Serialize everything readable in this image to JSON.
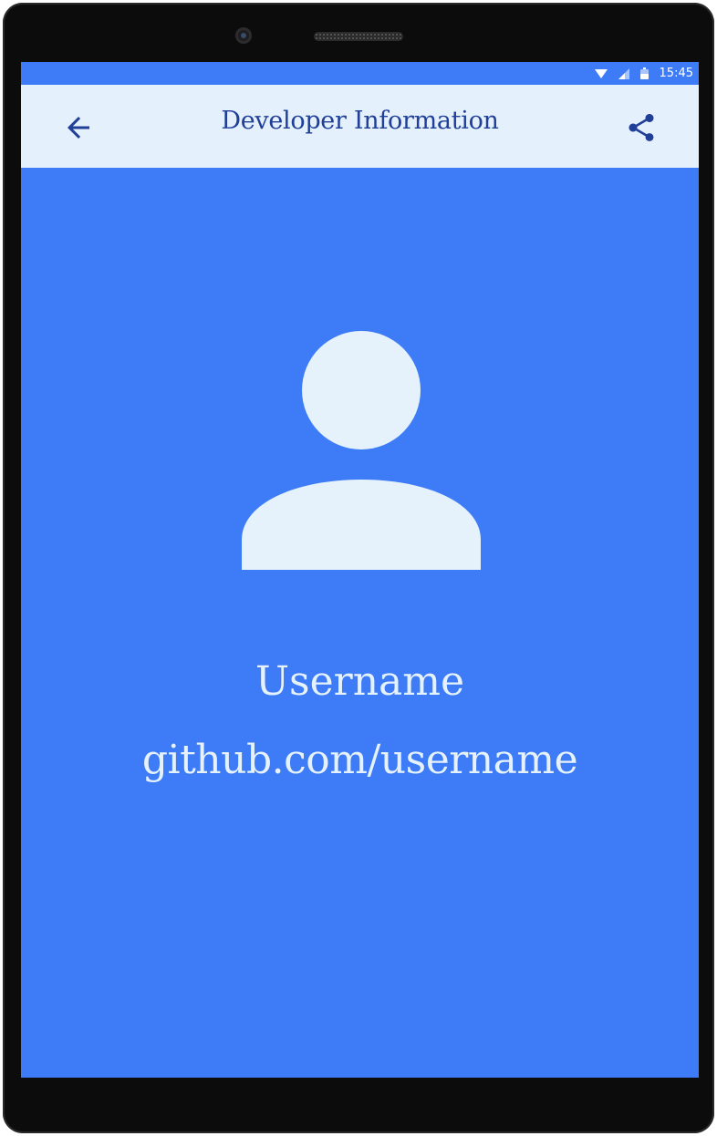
{
  "status_bar": {
    "time": "15:45"
  },
  "toolbar": {
    "title": "Developer Information",
    "back_icon": "arrow-back-icon",
    "share_icon": "share-icon"
  },
  "profile": {
    "avatar_icon": "person-icon",
    "username": "Username",
    "github": "github.com/username"
  },
  "colors": {
    "screen_background": "#3d7cf6",
    "toolbar_background": "#e4f0fb",
    "toolbar_foreground": "#1f3f98",
    "profile_foreground": "#e5f1fb"
  }
}
